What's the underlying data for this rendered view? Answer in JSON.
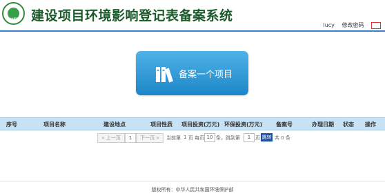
{
  "app": {
    "title": "建设项目环境影响登记表备案系统",
    "logo_text": "环保"
  },
  "user": {
    "name": "lucy",
    "change_password": "修改密码"
  },
  "main_action": {
    "label": "备案一个项目"
  },
  "table": {
    "columns": [
      "序号",
      "项目名称",
      "建设地点",
      "项目性质",
      "项目投资(万元)",
      "环保投资(万元)",
      "备案号",
      "办理日期",
      "状态",
      "操作"
    ]
  },
  "pager": {
    "prev": "« 上一页",
    "current_page": "1",
    "next": "下一页 »",
    "info_prefix": "当前第",
    "info_page": "1",
    "info_mid": "页 每页",
    "page_size": "10",
    "info_mid2": "条，跳到第",
    "jump_value": "1",
    "info_suffix": "页",
    "go_label": "跳转",
    "total_text": "共 0 条"
  },
  "footer": {
    "text": "版权所有：中华人民共和国环境保护部"
  },
  "colors": {
    "accent_blue": "#1e86c8",
    "header_line": "#3b7fc4",
    "table_header_bg": "#c9e2f3",
    "title_green": "#1a5a2a"
  }
}
